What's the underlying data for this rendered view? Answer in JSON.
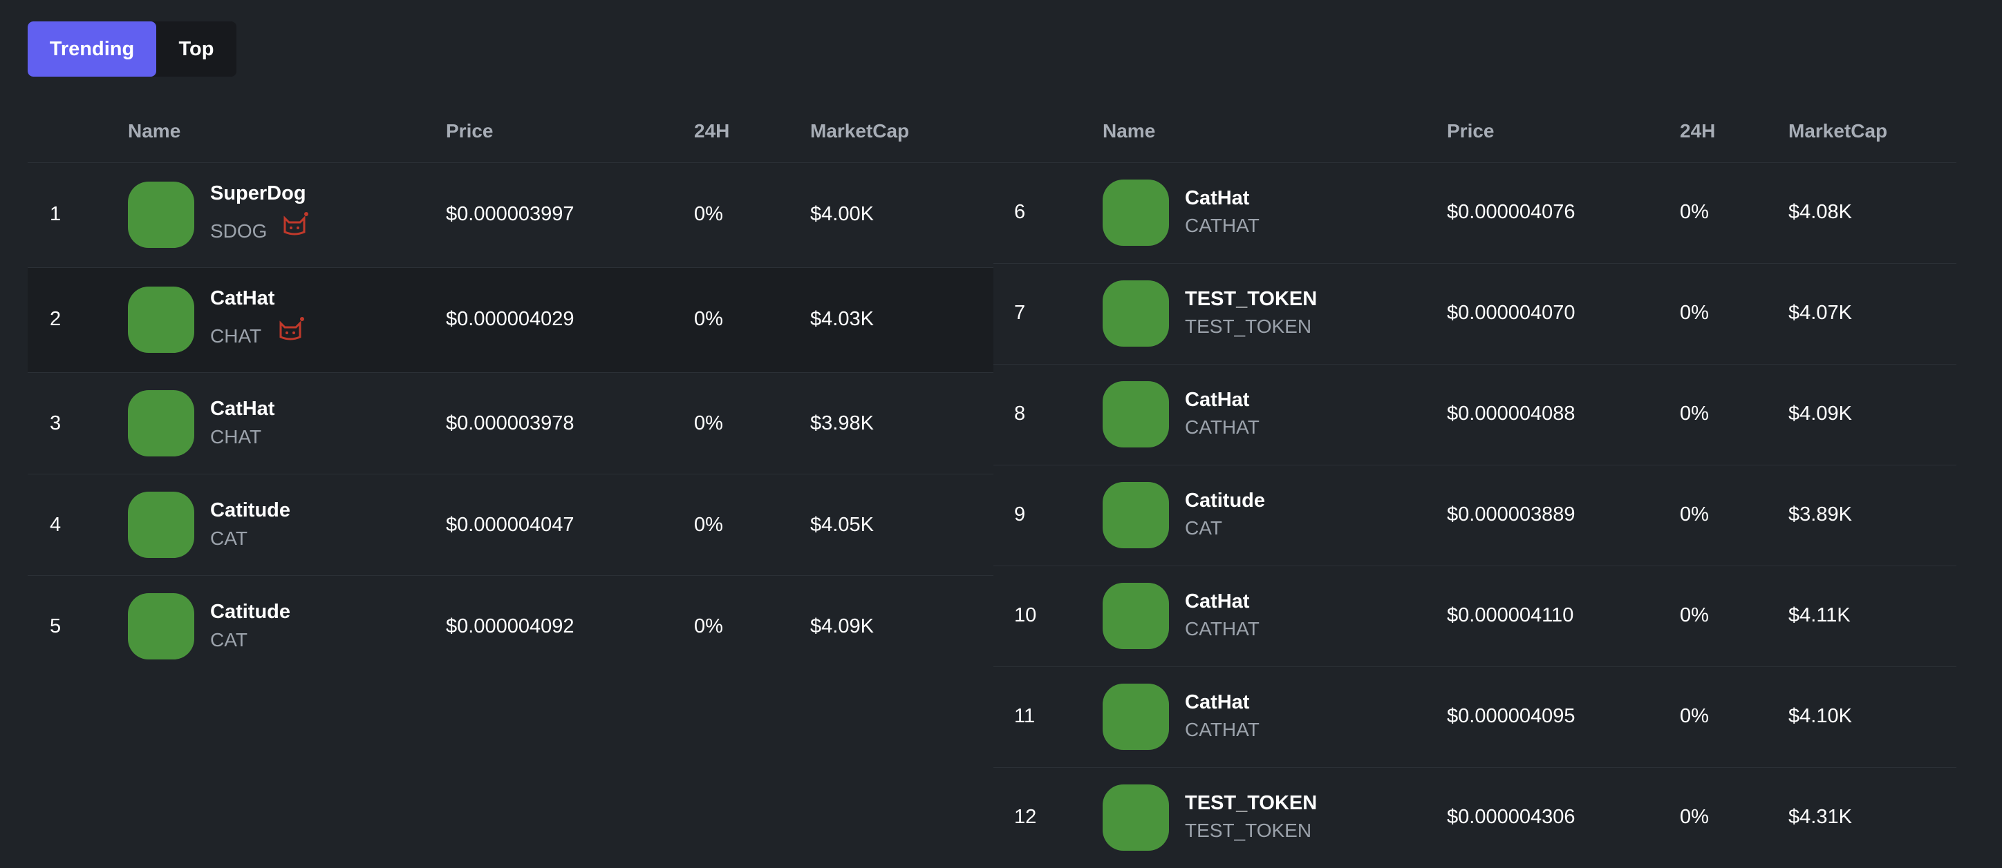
{
  "tabs": {
    "trending": "Trending",
    "top": "Top"
  },
  "columns": {
    "name": "Name",
    "price": "Price",
    "change": "24H",
    "marketcap": "MarketCap"
  },
  "left_rows": [
    {
      "rank": "1",
      "name": "SuperDog",
      "symbol": "SDOG",
      "price": "$0.000003997",
      "change": "0%",
      "marketcap": "$4.00K",
      "badge": true
    },
    {
      "rank": "2",
      "name": "CatHat",
      "symbol": "CHAT",
      "price": "$0.000004029",
      "change": "0%",
      "marketcap": "$4.03K",
      "badge": true
    },
    {
      "rank": "3",
      "name": "CatHat",
      "symbol": "CHAT",
      "price": "$0.000003978",
      "change": "0%",
      "marketcap": "$3.98K",
      "badge": false
    },
    {
      "rank": "4",
      "name": "Catitude",
      "symbol": "CAT",
      "price": "$0.000004047",
      "change": "0%",
      "marketcap": "$4.05K",
      "badge": false
    },
    {
      "rank": "5",
      "name": "Catitude",
      "symbol": "CAT",
      "price": "$0.000004092",
      "change": "0%",
      "marketcap": "$4.09K",
      "badge": false
    }
  ],
  "right_rows": [
    {
      "rank": "6",
      "name": "CatHat",
      "symbol": "CATHAT",
      "price": "$0.000004076",
      "change": "0%",
      "marketcap": "$4.08K"
    },
    {
      "rank": "7",
      "name": "TEST_TOKEN",
      "symbol": "TEST_TOKEN",
      "price": "$0.000004070",
      "change": "0%",
      "marketcap": "$4.07K"
    },
    {
      "rank": "8",
      "name": "CatHat",
      "symbol": "CATHAT",
      "price": "$0.000004088",
      "change": "0%",
      "marketcap": "$4.09K"
    },
    {
      "rank": "9",
      "name": "Catitude",
      "symbol": "CAT",
      "price": "$0.000003889",
      "change": "0%",
      "marketcap": "$3.89K"
    },
    {
      "rank": "10",
      "name": "CatHat",
      "symbol": "CATHAT",
      "price": "$0.000004110",
      "change": "0%",
      "marketcap": "$4.11K"
    },
    {
      "rank": "11",
      "name": "CatHat",
      "symbol": "CATHAT",
      "price": "$0.000004095",
      "change": "0%",
      "marketcap": "$4.10K"
    },
    {
      "rank": "12",
      "name": "TEST_TOKEN",
      "symbol": "TEST_TOKEN",
      "price": "$0.000004306",
      "change": "0%",
      "marketcap": "$4.31K"
    }
  ],
  "colors": {
    "accent": "#6160f0",
    "logo": "#4a943c",
    "badge": "#c0392b"
  },
  "icons": {
    "badge": "cat-face-icon"
  }
}
